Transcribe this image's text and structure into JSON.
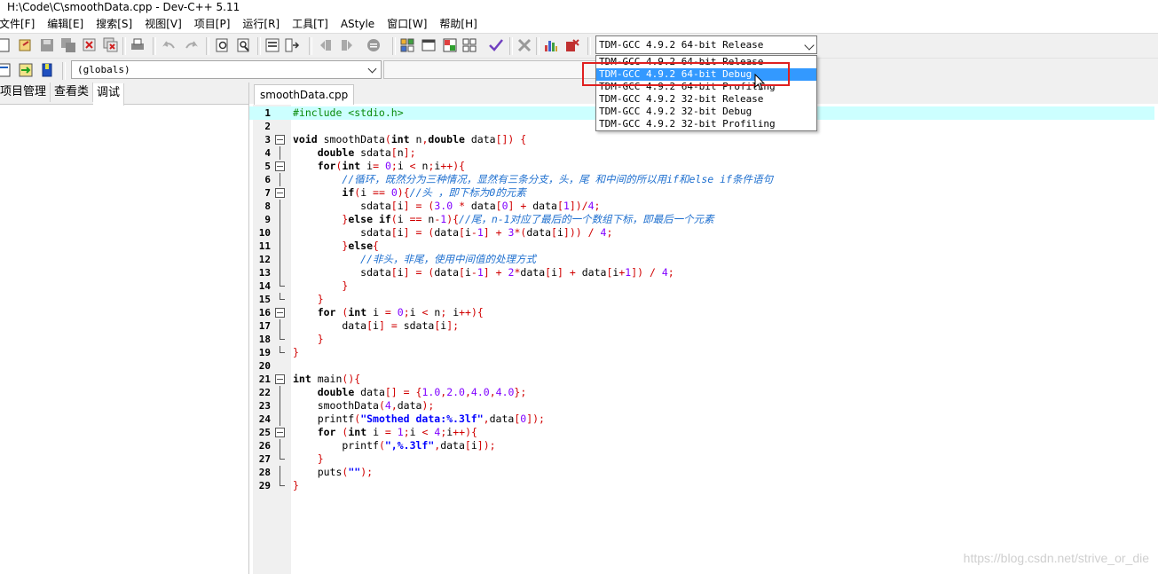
{
  "window": {
    "title": "H:\\Code\\C\\smoothData.cpp - Dev-C++ 5.11"
  },
  "menu": [
    "文件[F]",
    "编辑[E]",
    "搜索[S]",
    "视图[V]",
    "项目[P]",
    "运行[R]",
    "工具[T]",
    "AStyle",
    "窗口[W]",
    "帮助[H]"
  ],
  "compiler": {
    "selected": "TDM-GCC 4.9.2 64-bit Release",
    "options": [
      "TDM-GCC 4.9.2 64-bit Release",
      "TDM-GCC 4.9.2 64-bit Debug",
      "TDM-GCC 4.9.2 64-bit Profiling",
      "TDM-GCC 4.9.2 32-bit Release",
      "TDM-GCC 4.9.2 32-bit Debug",
      "TDM-GCC 4.9.2 32-bit Profiling"
    ],
    "highlighted_index": 1
  },
  "scope_combo": "(globals)",
  "left_tabs": [
    "项目管理",
    "查看类",
    "调试"
  ],
  "left_active_tab": 2,
  "editor": {
    "file_tab": "smoothData.cpp",
    "lines": [
      "1",
      "2",
      "3",
      "4",
      "5",
      "6",
      "7",
      "8",
      "9",
      "10",
      "11",
      "12",
      "13",
      "14",
      "15",
      "16",
      "17",
      "18",
      "19",
      "20",
      "21",
      "22",
      "23",
      "24",
      "25",
      "26",
      "27",
      "28",
      "29"
    ],
    "comments": {
      "c6": "//循环，既然分为三种情况，显然有三条分支，头，尾 和中间的所以用if和else if条件语句",
      "c7": "//头 ，即下标为0的元素",
      "c9": "//尾，n-1对应了最后的一个数组下标，即最后一个元素",
      "c11": "//非头，非尾，使用中间值的处理方式"
    },
    "strings": {
      "s24": "\"Smothed data:%.3lf\"",
      "s26": "\",%.3lf\"",
      "s28": "\"\""
    }
  },
  "watermark": "https://blog.csdn.net/strive_or_die",
  "colors": {
    "highlight_line": "#ccffff",
    "selection": "#3399ff",
    "annotation_box": "#e02020",
    "comment": "#1e6fcf"
  }
}
